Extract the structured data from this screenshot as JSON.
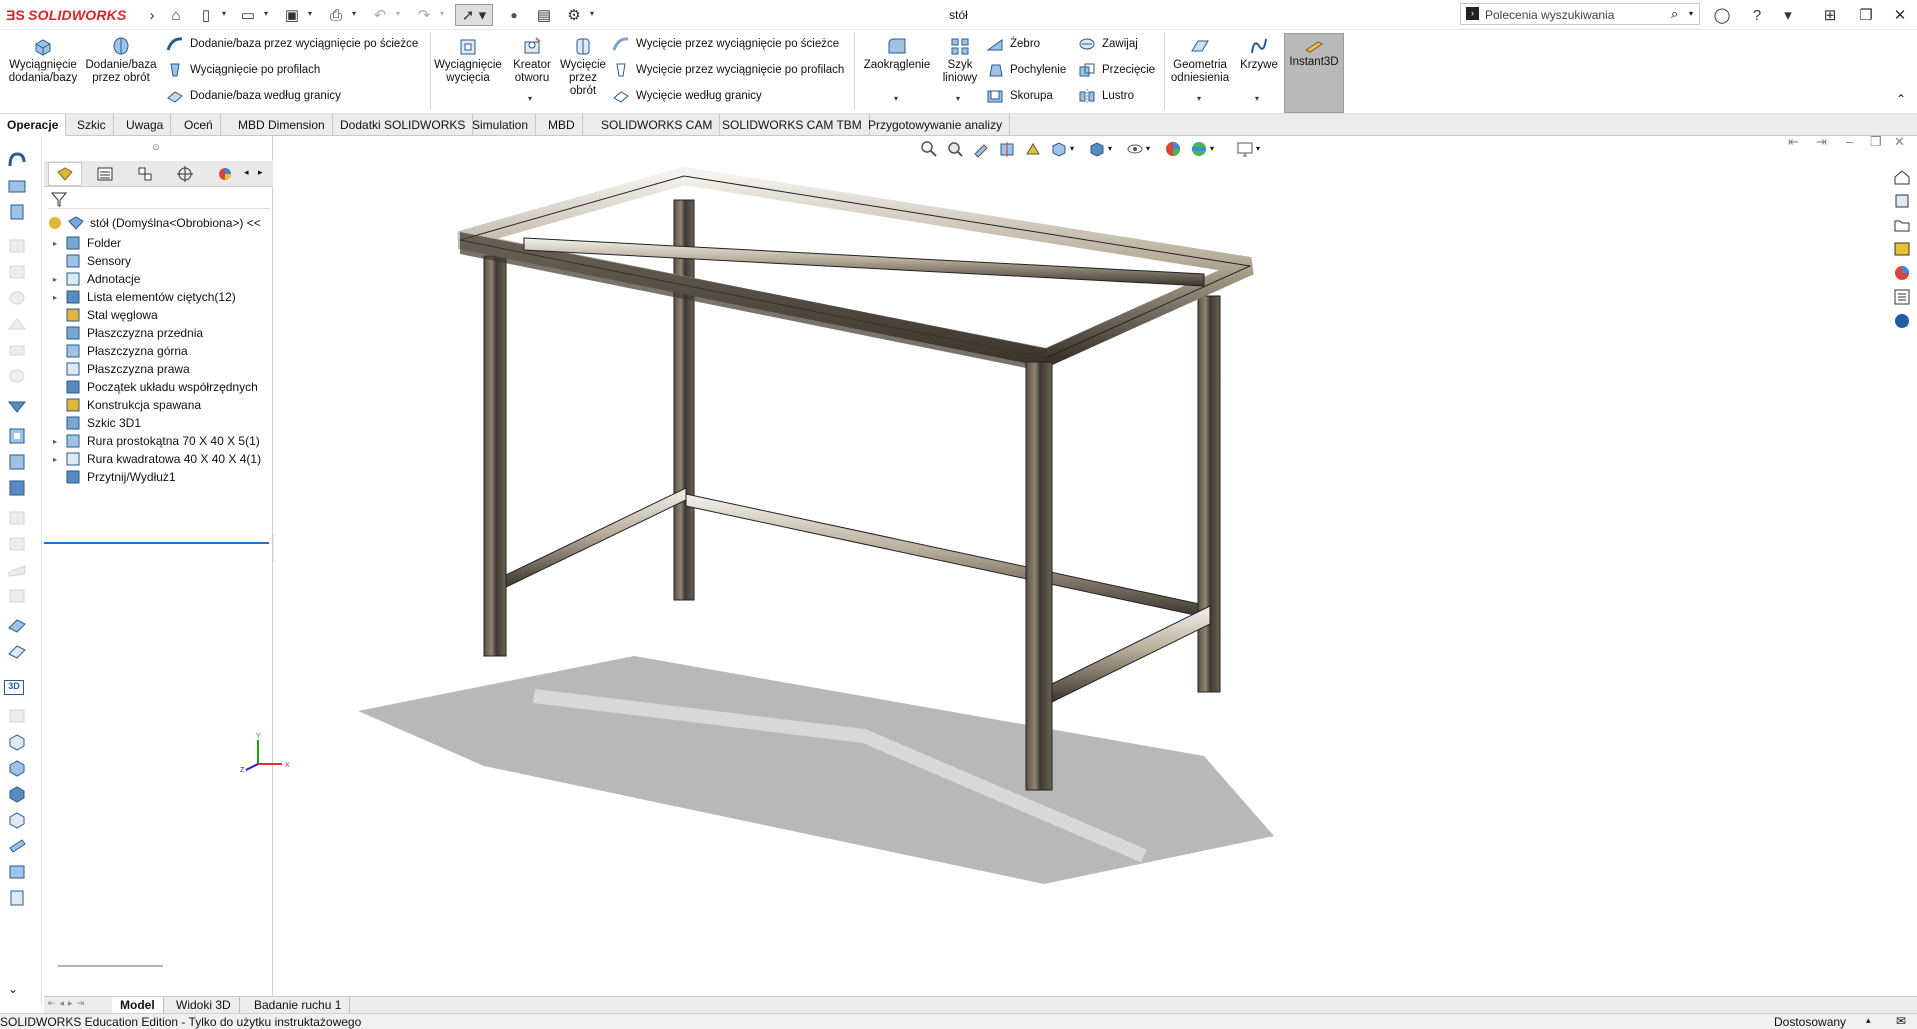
{
  "app": {
    "name": "SOLIDWORKS",
    "doc_title": "stół"
  },
  "search": {
    "placeholder": "Polecenia wyszukiwania"
  },
  "ribbon": {
    "extrude_boss": "Wyciągnięcie dodania/bazy",
    "revolve_boss": "Dodanie/baza przez obrót",
    "swept_boss": "Dodanie/baza przez wyciągnięcie po ścieżce",
    "lofted_boss": "Wyciągnięcie po profilach",
    "boundary_boss": "Dodanie/baza według granicy",
    "extrude_cut": "Wyciągnięcie wycięcia",
    "hole_wizard": "Kreator otworu",
    "revolved_cut": "Wycięcie przez obrót",
    "swept_cut": "Wycięcie przez wyciągnięcie po ścieżce",
    "lofted_cut": "Wycięcie przez wyciągnięcie po profilach",
    "boundary_cut": "Wycięcie według granicy",
    "fillet": "Zaokrąglenie",
    "linear_pattern": "Szyk liniowy",
    "rib": "Żebro",
    "draft": "Pochylenie",
    "shell": "Skorupa",
    "wrap": "Zawijaj",
    "intersect": "Przecięcie",
    "mirror": "Lustro",
    "ref_geometry": "Geometria odniesienia",
    "curves": "Krzywe",
    "instant3d": "Instant3D"
  },
  "tabs": [
    "Operacje",
    "Szkic",
    "Uwaga",
    "Oceń",
    "MBD Dimension",
    "Dodatki SOLIDWORKS",
    "Simulation",
    "MBD",
    "SOLIDWORKS CAM",
    "SOLIDWORKS CAM TBM",
    "Przygotowywanie analizy"
  ],
  "tree": {
    "root": "stół (Domyślna<Obrobiona>) <<",
    "items": [
      {
        "label": "Folder",
        "expand": true
      },
      {
        "label": "Sensory",
        "expand": false
      },
      {
        "label": "Adnotacje",
        "expand": true
      },
      {
        "label": "Lista elementów ciętych(12)",
        "expand": true
      },
      {
        "label": "Stal węglowa",
        "expand": false
      },
      {
        "label": "Płaszczyzna przednia",
        "expand": false
      },
      {
        "label": "Płaszczyzna górna",
        "expand": false
      },
      {
        "label": "Płaszczyzna prawa",
        "expand": false
      },
      {
        "label": "Początek układu współrzędnych",
        "expand": false
      },
      {
        "label": "Konstrukcja spawana",
        "expand": false
      },
      {
        "label": "Szkic 3D1",
        "expand": false
      },
      {
        "label": "Rura prostokątna 70 X 40 X 5(1)",
        "expand": true
      },
      {
        "label": "Rura kwadratowa 40 X 40 X 4(1)",
        "expand": true
      },
      {
        "label": "Przytnij/Wydłuż1",
        "expand": false
      }
    ]
  },
  "bottom_tabs": [
    "Model",
    "Widoki 3D",
    "Badanie ruchu 1"
  ],
  "status": {
    "left": "SOLIDWORKS Education Edition - Tylko do użytku instruktażowego",
    "right": "Dostosowany"
  },
  "triad": {
    "x": "X",
    "y": "Y",
    "z": "Z"
  },
  "colors": {
    "brand": "#d9232a",
    "tree_accent": "#1a73d9",
    "instant3d_bg": "#b9b9b9"
  }
}
